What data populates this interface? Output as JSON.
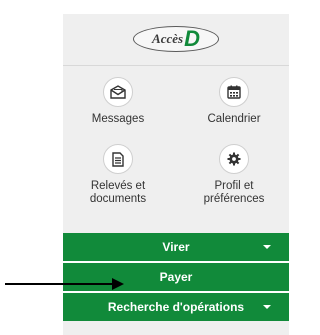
{
  "logo": {
    "word": "Accès",
    "letter": "D"
  },
  "tiles": [
    {
      "label": "Messages",
      "icon": "envelope-icon"
    },
    {
      "label": "Calendrier",
      "icon": "calendar-icon"
    },
    {
      "label": "Relevés et\ndocuments",
      "icon": "document-icon"
    },
    {
      "label": "Profil et\npréférences",
      "icon": "gear-icon"
    }
  ],
  "menu": {
    "items": [
      {
        "label": "Virer",
        "has_dropdown": true
      },
      {
        "label": "Payer",
        "has_dropdown": false
      },
      {
        "label": "Recherche d'opérations",
        "has_dropdown": true
      }
    ]
  },
  "colors": {
    "accent_green": "#118a3a",
    "panel_bg": "#efefef"
  }
}
